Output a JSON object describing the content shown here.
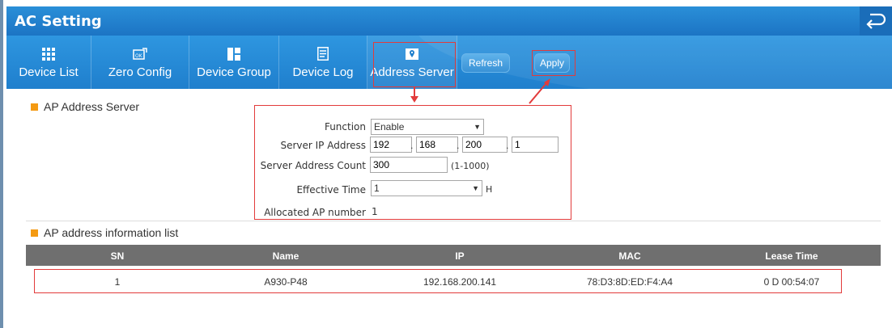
{
  "window": {
    "title": "AC Setting"
  },
  "toolbar": {
    "items": [
      {
        "label": "Device List",
        "icon": "grid-icon"
      },
      {
        "label": "Zero Config",
        "icon": "ok-config-icon"
      },
      {
        "label": "Device Group",
        "icon": "group-icon"
      },
      {
        "label": "Device Log",
        "icon": "log-icon"
      },
      {
        "label": "Address Server",
        "icon": "location-pin-icon"
      }
    ],
    "refresh_label": "Refresh",
    "apply_label": "Apply"
  },
  "server_section": {
    "title": "AP Address Server",
    "function_label": "Function",
    "function_value": "Enable",
    "ip_label": "Server IP Address",
    "ip_octets": [
      "192",
      "168",
      "200",
      "1"
    ],
    "count_label": "Server Address Count",
    "count_value": "300",
    "count_range": "(1-1000)",
    "time_label": "Effective Time",
    "time_value": "1",
    "time_unit": "H",
    "allocated_label": "Allocated AP number",
    "allocated_value": "1"
  },
  "list_section": {
    "title": "AP address information list",
    "columns": [
      "SN",
      "Name",
      "IP",
      "MAC",
      "Lease Time"
    ],
    "rows": [
      [
        "1",
        "A930-P48",
        "192.168.200.141",
        "78:D3:8D:ED:F4:A4",
        "0 D 00:54:07"
      ]
    ]
  },
  "colors": {
    "header_blue": "#1c74c4",
    "accent_orange": "#f49a12",
    "highlight_red": "#e23b3b",
    "table_header": "#6f6f6f"
  }
}
